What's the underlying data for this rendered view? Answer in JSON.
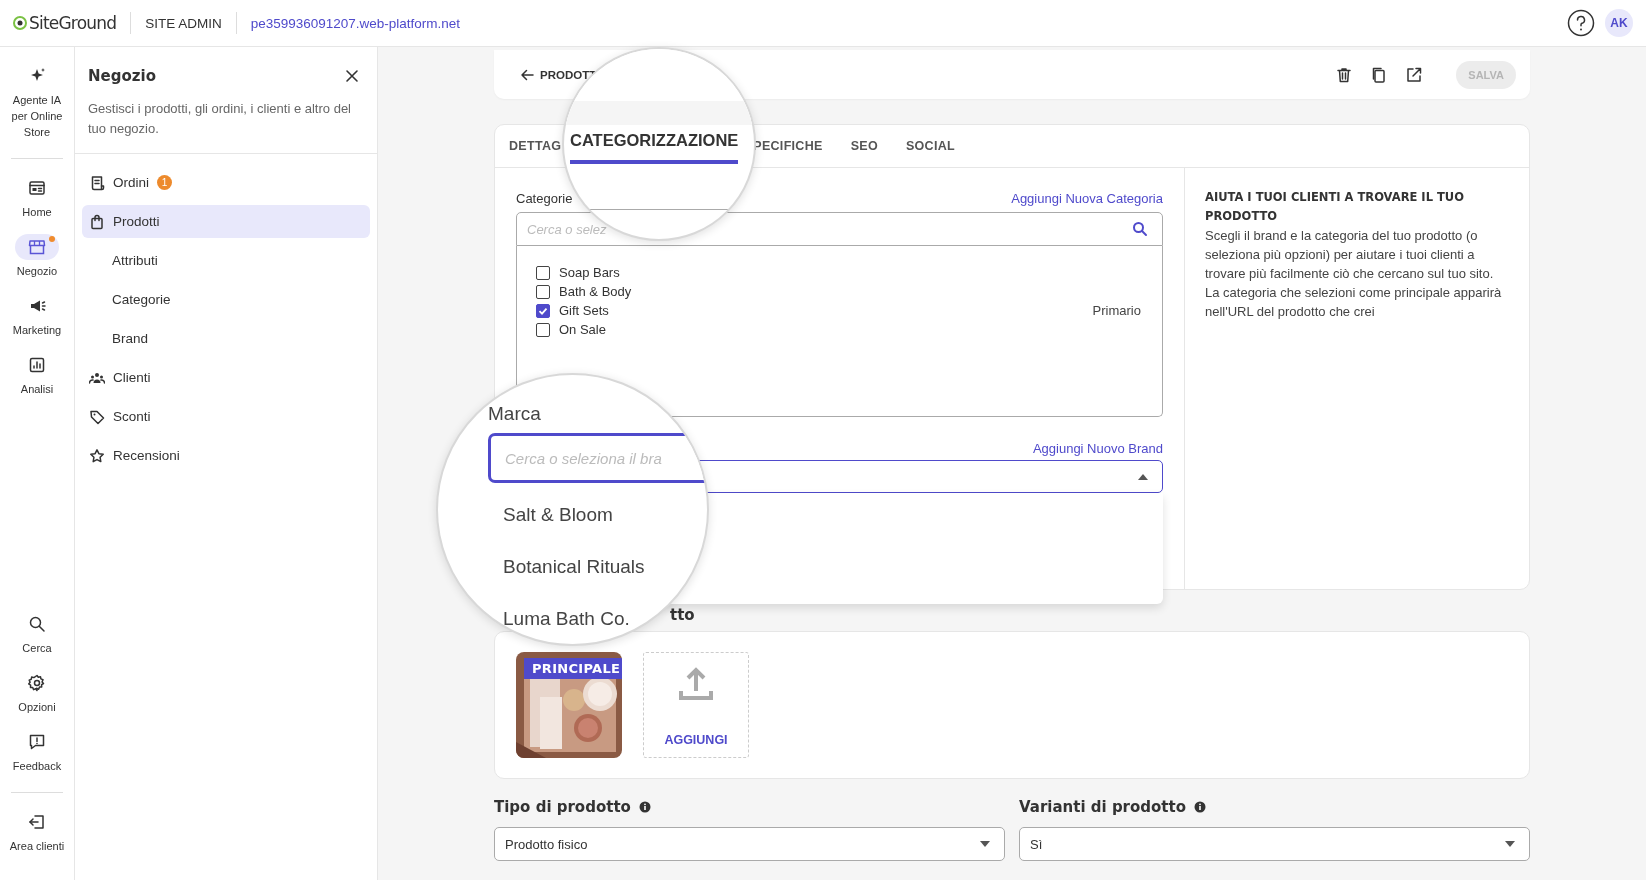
{
  "topbar": {
    "logo": "SiteGround",
    "section": "SITE ADMIN",
    "domain": "pe359936091207.web-platform.net",
    "avatar": "AK"
  },
  "rail": {
    "top": [
      {
        "label": "Agente IA per Online Store",
        "selected": false,
        "notification": false
      },
      {
        "label": "Home",
        "selected": false,
        "notification": false
      },
      {
        "label": "Negozio",
        "selected": true,
        "notification": true
      },
      {
        "label": "Marketing",
        "selected": false,
        "notification": false
      },
      {
        "label": "Analisi",
        "selected": false,
        "notification": false
      }
    ],
    "bottom": [
      {
        "label": "Cerca",
        "selected": false,
        "notification": false
      },
      {
        "label": "Opzioni",
        "selected": false,
        "notification": false
      },
      {
        "label": "Feedback",
        "selected": false,
        "notification": false
      },
      {
        "label": "Area clienti",
        "selected": false,
        "notification": false
      }
    ]
  },
  "panel": {
    "title": "Negozio",
    "description": "Gestisci i prodotti, gli ordini, i clienti e altro del tuo negozio.",
    "items": [
      {
        "label": "Ordini",
        "badge": "1",
        "selected": false
      },
      {
        "label": "Prodotti",
        "selected": true,
        "children": [
          {
            "label": "Attributi",
            "selected": false
          },
          {
            "label": "Categorie",
            "selected": false
          },
          {
            "label": "Brand",
            "selected": false
          }
        ]
      },
      {
        "label": "Clienti",
        "selected": false
      },
      {
        "label": "Sconti",
        "selected": false
      },
      {
        "label": "Recensioni",
        "selected": false
      }
    ]
  },
  "product": {
    "back": "PRODOTT",
    "save": {
      "label": "SALVA",
      "disabled": true
    },
    "tabs": [
      {
        "label": "DETTAG",
        "selected": false
      },
      {
        "label": "PECIFICHE",
        "selected": false
      },
      {
        "label": "SEO",
        "selected": false
      },
      {
        "label": "SOCIAL",
        "selected": false
      }
    ],
    "categories": {
      "label": "Categorie",
      "add_link": "Aggiungi Nuova Categoria",
      "placeholder": "Cerca o selez",
      "items": [
        {
          "label": "Soap Bars",
          "checked": false
        },
        {
          "label": "Bath & Body",
          "checked": false
        },
        {
          "label": "Gift Sets",
          "checked": true,
          "tag": "Primario"
        },
        {
          "label": "On Sale",
          "checked": false
        }
      ]
    },
    "brand": {
      "add_link": "Aggiungi Nuovo Brand",
      "expanded": true
    },
    "help": {
      "title": "AIUTA I TUOI CLIENTI A TROVARE IL TUO PRODOTTO",
      "text": "Scegli il brand e la categoria del tuo prodotto (o seleziona più opzioni) per aiutare i tuoi clienti a trovare più facilmente ciò che cercano sul tuo sito. La categoria che selezioni come principale apparirà nell'URL del prodotto che crei"
    },
    "images": {
      "title": "tto",
      "items": [
        {
          "kind": "picture",
          "badge": "PRINCIPALE"
        }
      ],
      "add": "AGGIUNGI"
    },
    "fields": [
      {
        "label": "Tipo di prodotto",
        "value": "Prodotto fisico"
      },
      {
        "label": "Varianti di prodotto",
        "value": "Sì"
      }
    ]
  },
  "magnifiers": [
    {
      "kind": "tab",
      "label": "CATEGORIZZAZIONE",
      "selected": true
    },
    {
      "kind": "brand",
      "label": "Marca",
      "placeholder": "Cerca o seleziona il bra",
      "options": [
        "Salt & Bloom",
        "Botanical Rituals",
        "Luma Bath Co."
      ]
    }
  ]
}
